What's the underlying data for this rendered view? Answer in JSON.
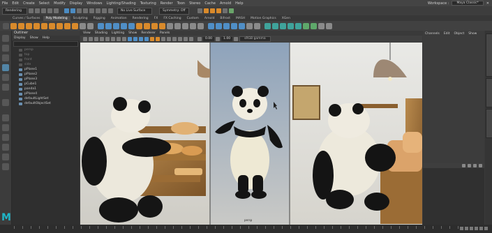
{
  "menubar": {
    "items": [
      "File",
      "Edit",
      "Create",
      "Select",
      "Modify",
      "Display",
      "Windows",
      "Lighting/Shading",
      "Texturing",
      "Render",
      "Toon",
      "Stereo",
      "Cache",
      "Arnold",
      "Help"
    ],
    "workspace_label": "Workspace :",
    "workspace_value": "Maya Classic*"
  },
  "statusline": {
    "menuset": "Rendering",
    "live_surface": "No Live Surface",
    "symmetry": "Symmetry: Off"
  },
  "shelf_tabs": [
    "Curves / Surfaces",
    "Poly Modeling",
    "Sculpting",
    "Rigging",
    "Animation",
    "Rendering",
    "FX",
    "FX Caching",
    "Custom",
    "Arnold",
    "Bifrost",
    "MASH",
    "Motion Graphics",
    "XGen"
  ],
  "shelf_active_tab": "Poly Modeling",
  "outliner": {
    "title": "Outliner",
    "menu": [
      "Display",
      "Show",
      "Help"
    ],
    "items": [
      {
        "label": "persp",
        "dim": true
      },
      {
        "label": "top",
        "dim": true
      },
      {
        "label": "front",
        "dim": true
      },
      {
        "label": "side",
        "dim": true
      },
      {
        "label": "pPlane1",
        "dim": false
      },
      {
        "label": "pPlane2",
        "dim": false
      },
      {
        "label": "pPlane3",
        "dim": false
      },
      {
        "label": "pCube1",
        "dim": false
      },
      {
        "label": "panda1",
        "dim": false
      },
      {
        "label": "pPlane4",
        "dim": false
      },
      {
        "label": "defaultLightSet",
        "dim": false
      },
      {
        "label": "defaultObjectSet",
        "dim": false
      }
    ]
  },
  "viewport": {
    "menu": [
      "View",
      "Shading",
      "Lighting",
      "Show",
      "Renderer",
      "Panels"
    ],
    "value_a": "0.00",
    "value_b": "1.00",
    "camera": "sRGB gamma",
    "center_caption": "persp"
  },
  "channelbox": {
    "menu": [
      "Channels",
      "Edit",
      "Object",
      "Show"
    ]
  },
  "colors": {
    "accent": "#1fb5c7",
    "orange_icon": "#d98a2b",
    "blue_icon": "#4f8ec6",
    "selected_tool": "#5285a6"
  },
  "logo": "M"
}
